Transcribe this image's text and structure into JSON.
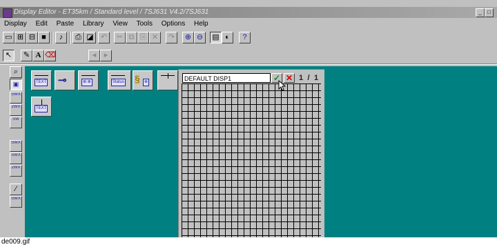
{
  "window": {
    "title": "Display Editor - ET35km / Standard level / 7SJ631 V4.2/7SJ631",
    "min_glyph": "_",
    "max_glyph": "□"
  },
  "menu": [
    "Display",
    "Edit",
    "Paste",
    "Library",
    "View",
    "Tools",
    "Options",
    "Help"
  ],
  "toolbar_icons": [
    "new-icon",
    "open-icon",
    "open-folder-icon",
    "save-icon",
    "library-icon",
    "print-icon",
    "print-preview-icon",
    "undo-icon",
    "cut-icon",
    "copy-icon",
    "paste-icon",
    "delete-icon",
    "redo-icon",
    "zoom-in-icon",
    "zoom-out-icon",
    "grid-view-icon",
    "contrast-icon",
    "help-icon"
  ],
  "toolbar2": {
    "arrow_glyph": "↖",
    "text_glyph": "A",
    "nav_left": "◂",
    "nav_right": "▸"
  },
  "palette_labels": [
    "SWX",
    "2WX",
    "SW",
    "SWX",
    "SWX",
    "2WX",
    "SWX",
    "SWX"
  ],
  "library_items": [
    {
      "label": "TEXT"
    },
    {
      "label": ""
    },
    {
      "label": "⊗:⊗"
    },
    {
      "label": "Status"
    },
    {
      "label": "⊗"
    },
    {
      "label": "TEXT"
    }
  ],
  "editor": {
    "display_name": "DEFAULT DISP1",
    "ok_glyph": "✓",
    "cancel_glyph": "✕",
    "page_current": "1",
    "page_sep": "/",
    "page_total": "1"
  },
  "caption": "de009.gif"
}
